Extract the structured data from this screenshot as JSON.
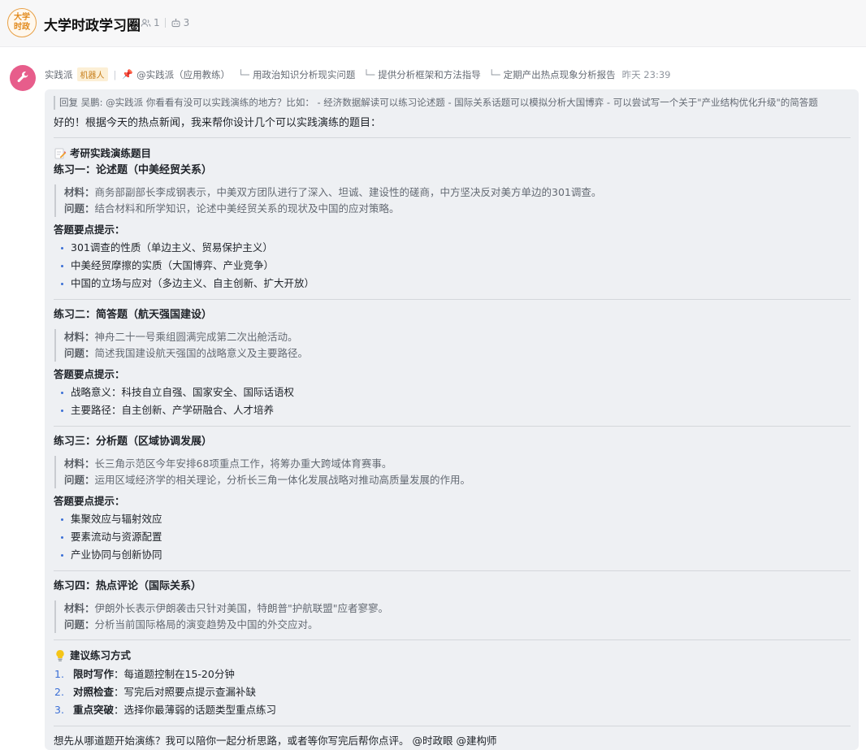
{
  "header": {
    "group_avatar_text": "大学时政",
    "group_title": "大学时政学习圈",
    "member_count": "1",
    "bot_count": "3"
  },
  "message": {
    "sender": "实践派",
    "bot_badge": "机器人",
    "pin_text": "@实践派（应用教练）",
    "threads": [
      "用政治知识分析现实问题",
      "提供分析框架和方法指导",
      "定期产出热点现象分析报告"
    ],
    "time": "昨天 23:39",
    "reply_quote": "回复 吴鹏: @实践派 你看看有没可以实践演练的地方？比如： - 经济数据解读可以练习论述题 - 国际关系话题可以模拟分析大国博弈 - 可以尝试写一个关于\"产业结构优化升级\"的简答题",
    "greeting": "好的！根据今天的热点新闻，我来帮你设计几个可以实践演练的题目：",
    "section_title": "考研实践演练题目",
    "exercises": [
      {
        "title": "练习一：论述题（中美经贸关系）",
        "material_label": "材料：",
        "material": "商务部副部长李成钢表示，中美双方团队进行了深入、坦诚、建设性的磋商，中方坚决反对美方单边的301调查。",
        "question_label": "问题：",
        "question": "结合材料和所学知识，论述中美经贸关系的现状及中国的应对策略。",
        "hint_title": "答题要点提示：",
        "points": [
          "301调查的性质（单边主义、贸易保护主义）",
          "中美经贸摩擦的实质（大国博弈、产业竞争）",
          "中国的立场与应对（多边主义、自主创新、扩大开放）"
        ]
      },
      {
        "title": "练习二：简答题（航天强国建设）",
        "material_label": "材料：",
        "material": "神舟二十一号乘组圆满完成第二次出舱活动。",
        "question_label": "问题：",
        "question": "简述我国建设航天强国的战略意义及主要路径。",
        "hint_title": "答题要点提示：",
        "points": [
          "战略意义：科技自立自强、国家安全、国际话语权",
          "主要路径：自主创新、产学研融合、人才培养"
        ]
      },
      {
        "title": "练习三：分析题（区域协调发展）",
        "material_label": "材料：",
        "material": "长三角示范区今年安排68项重点工作，将筹办重大跨域体育赛事。",
        "question_label": "问题：",
        "question": "运用区域经济学的相关理论，分析长三角一体化发展战略对推动高质量发展的作用。",
        "hint_title": "答题要点提示：",
        "points": [
          "集聚效应与辐射效应",
          "要素流动与资源配置",
          "产业协同与创新协同"
        ]
      },
      {
        "title": "练习四：热点评论（国际关系）",
        "material_label": "材料：",
        "material": "伊朗外长表示伊朗袭击只针对美国，特朗普\"护航联盟\"应者寥寥。",
        "question_label": "问题：",
        "question": "分析当前国际格局的演变趋势及中国的外交应对。"
      }
    ],
    "advice_title": "建议练习方式",
    "advice": [
      {
        "num": "1.",
        "label": "限时写作",
        "text": "：每道题控制在15-20分钟"
      },
      {
        "num": "2.",
        "label": "对照检查",
        "text": "：写完后对照要点提示查漏补缺"
      },
      {
        "num": "3.",
        "label": "重点突破",
        "text": "：选择你最薄弱的话题类型重点练习"
      }
    ],
    "closing": "想先从哪道题开始演练？我可以陪你一起分析思路，或者等你写完后帮你点评。 @时政眼 @建构师"
  }
}
